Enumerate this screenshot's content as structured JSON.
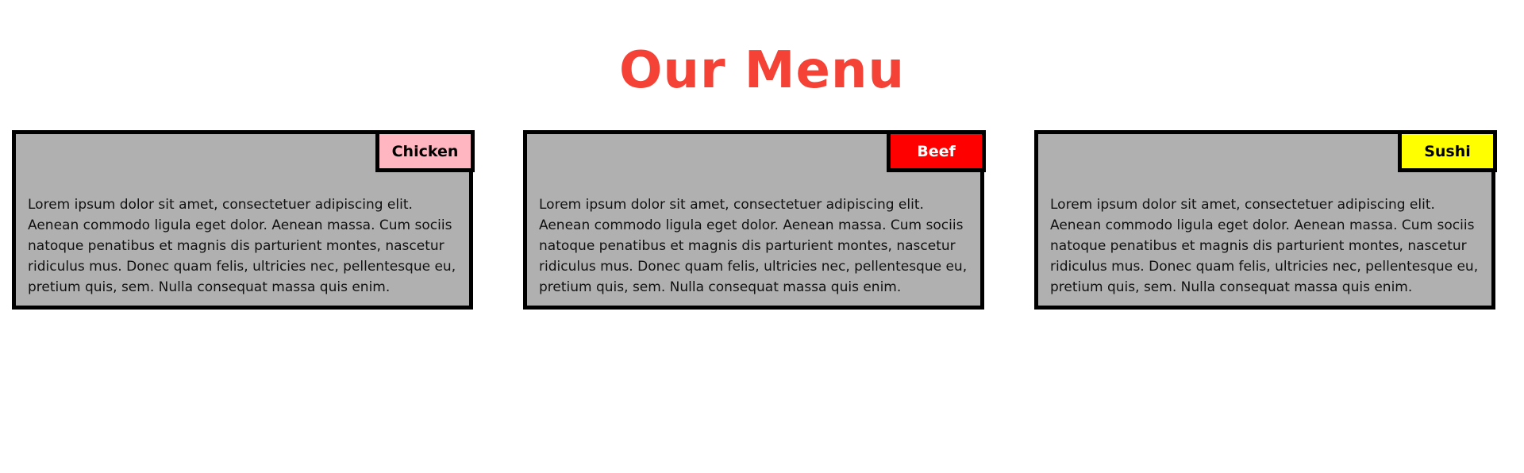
{
  "page": {
    "title": "Our Menu",
    "title_color": "#f44336"
  },
  "menu": {
    "items": [
      {
        "label": "Chicken",
        "badge_color": "#ffb6c1",
        "label_color": "#000000",
        "description": "Lorem ipsum dolor sit amet, consectetuer adipiscing elit. Aenean commodo ligula eget dolor. Aenean massa. Cum sociis natoque penatibus et magnis dis parturient montes, nascetur ridiculus mus. Donec quam felis, ultricies nec, pellentesque eu, pretium quis, sem. Nulla consequat massa quis enim."
      },
      {
        "label": "Beef",
        "badge_color": "#ff0000",
        "label_color": "#ffffff",
        "description": "Lorem ipsum dolor sit amet, consectetuer adipiscing elit. Aenean commodo ligula eget dolor. Aenean massa. Cum sociis natoque penatibus et magnis dis parturient montes, nascetur ridiculus mus. Donec quam felis, ultricies nec, pellentesque eu, pretium quis, sem. Nulla consequat massa quis enim."
      },
      {
        "label": "Sushi",
        "badge_color": "#ffff00",
        "label_color": "#000000",
        "description": "Lorem ipsum dolor sit amet, consectetuer adipiscing elit. Aenean commodo ligula eget dolor. Aenean massa. Cum sociis natoque penatibus et magnis dis parturient montes, nascetur ridiculus mus. Donec quam felis, ultricies nec, pellentesque eu, pretium quis, sem. Nulla consequat massa quis enim."
      }
    ]
  }
}
